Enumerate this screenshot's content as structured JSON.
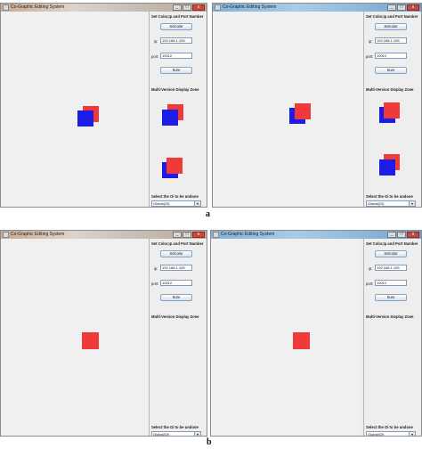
{
  "app_title": "Co-Graphic Editing System",
  "panel": {
    "set_title": "Set Color,Ip and Port Number",
    "selcolor_label": "Selcolor",
    "ip_label": "ip:",
    "ip_value": "192.168.1.105",
    "port_label": "port:",
    "port_value": "10012",
    "sure_label": "Sure",
    "multi_zone_title": "Multi-Version Display Zone",
    "select_oi_title": "Select the Oi to be undone",
    "select_value": "Global(OI)"
  },
  "captions": {
    "a": "a",
    "b": "b"
  },
  "colors": {
    "red": "#f03a3a",
    "blue": "#1c1ce6",
    "accent_blue": "#7fb1d8"
  },
  "icons": [
    "app-icon",
    "minimize-icon",
    "maximize-icon",
    "close-icon",
    "dropdown-arrow-icon"
  ]
}
